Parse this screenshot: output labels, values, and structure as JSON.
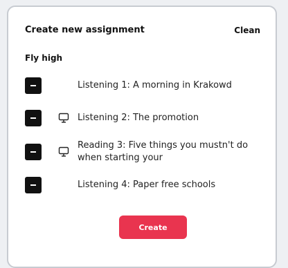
{
  "header": {
    "title": "Create new assignment",
    "clean_label": "Clean"
  },
  "course": {
    "name": "Fly high"
  },
  "items": [
    {
      "label": "Listening 1: A morning in Krakowd",
      "icon": ""
    },
    {
      "label": "Listening 2: The promotion",
      "icon": "monitor-icon"
    },
    {
      "label": "Reading 3: Five things you mustn't do when starting your",
      "icon": "monitor-icon"
    },
    {
      "label": "Listening 4: Paper free schools",
      "icon": ""
    }
  ],
  "actions": {
    "create_label": "Create",
    "create_color": "#e9344f"
  }
}
